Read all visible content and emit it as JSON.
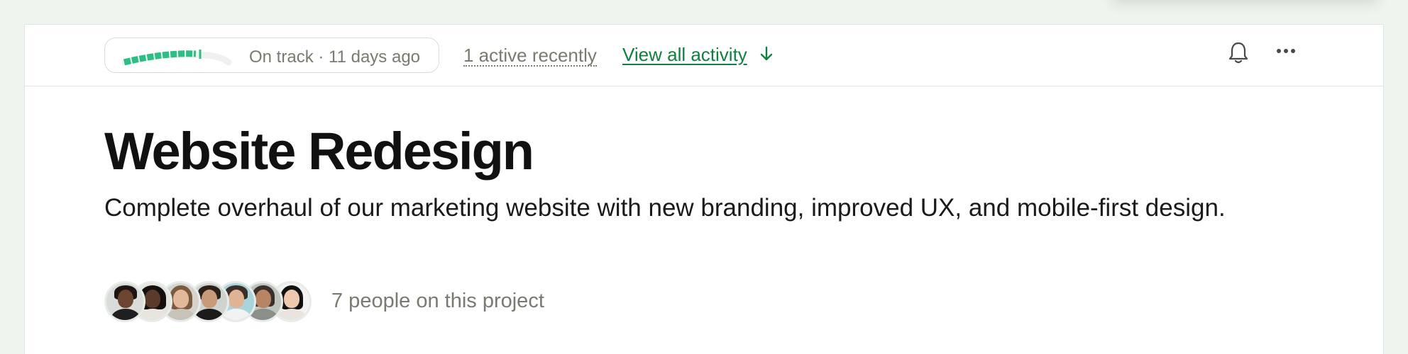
{
  "header": {
    "status": {
      "label": "On track · 11 days ago",
      "progress": 0.68,
      "color": "#2ebd85"
    },
    "active_label": "1 active recently",
    "view_activity_label": "View all activity",
    "icons": [
      "arrow-down-icon",
      "bell-icon",
      "more-icon"
    ]
  },
  "project": {
    "title": "Website Redesign",
    "description": "Complete overhaul of our marketing website with new branding, improved UX, and mobile-first design.",
    "people_label": "7 people on this project",
    "member_count": 7
  },
  "colors": {
    "accent_green": "#108040",
    "status_green": "#2ebd85",
    "muted_text": "#7a7a70",
    "page_bg": "#eef4ee"
  }
}
